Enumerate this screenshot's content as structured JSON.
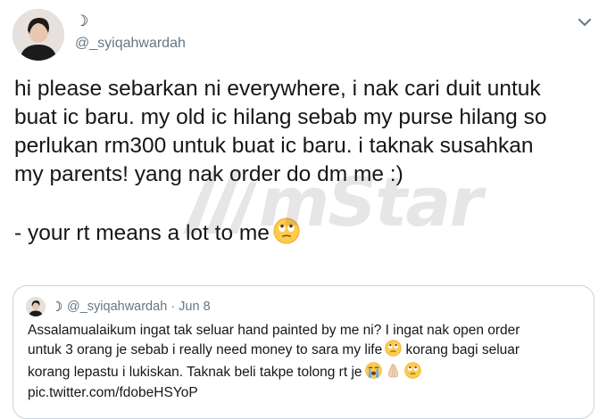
{
  "tweet": {
    "display_name": "☽",
    "handle": "@_syiqahwardah",
    "lines": [
      "hi please sebarkan ni everywhere, i nak cari duit untuk",
      "buat ic baru. my old ic hilang sebab my purse hilang so",
      "perlukan rm300 untuk buat ic baru. i taknak susahkan",
      "my parents! yang nak order do dm me :)"
    ],
    "closing_line": "- your rt means a lot to me",
    "closing_emoji": "rolling-eyes-face-icon"
  },
  "watermark": {
    "text": "mStar"
  },
  "quoted": {
    "display_name": "☽",
    "handle": "@_syiqahwardah",
    "separator": "·",
    "date": "Jun 8",
    "lines": [
      "Assalamualaikum ingat tak seluar hand painted by me ni? I ingat nak open order",
      "untuk 3 orang je sebab i really need money to sara my life",
      "korang bagi seluar",
      "korang lepastu i lukiskan. Taknak beli takpe tolong rt je",
      "pic.twitter.com/fdobeHSYoP"
    ]
  }
}
